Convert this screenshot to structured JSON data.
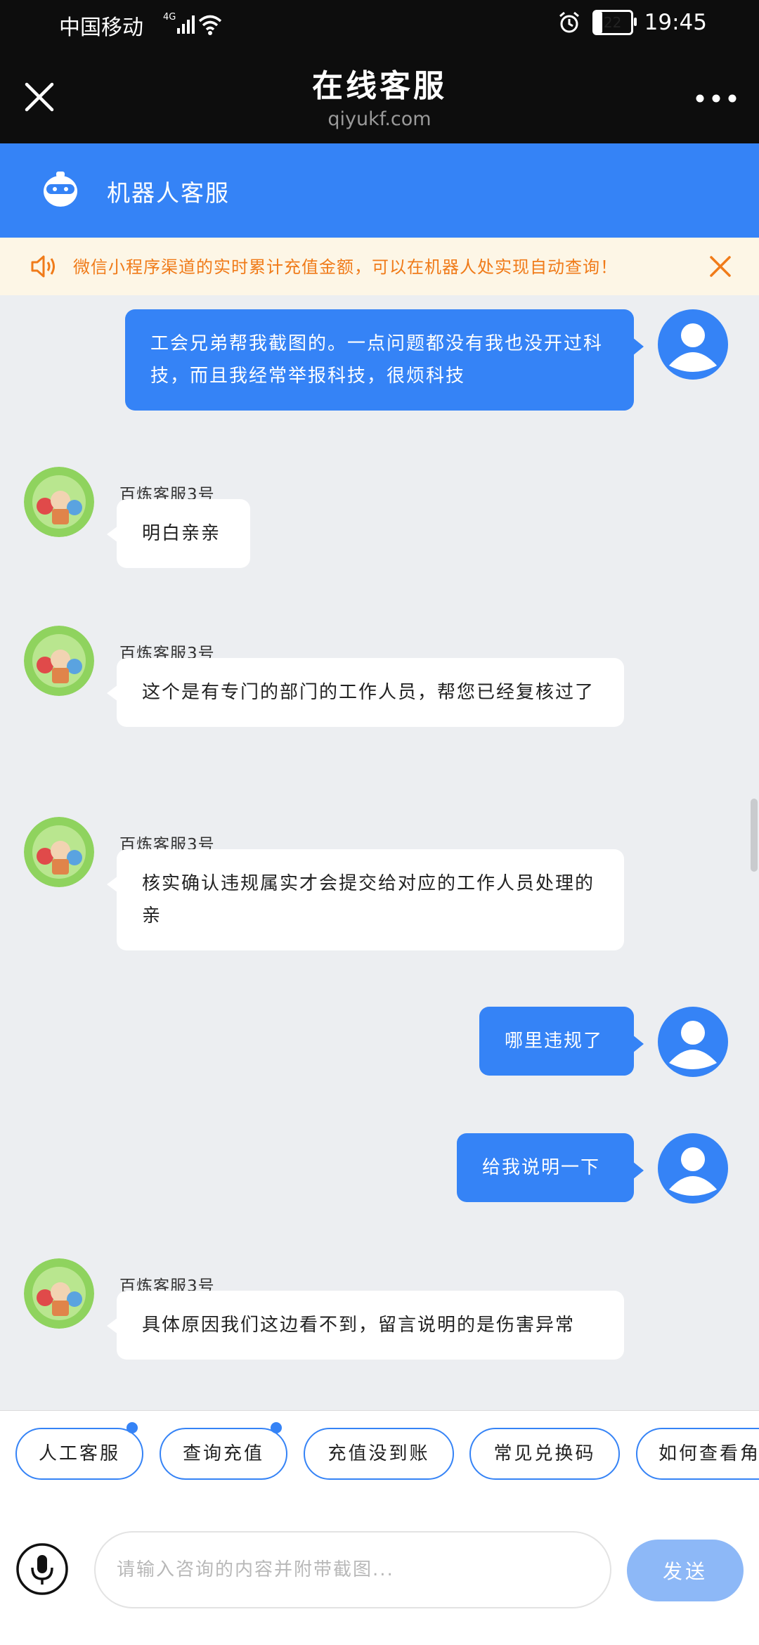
{
  "status_bar": {
    "carrier": "中国移动",
    "network": "4G",
    "battery": "22",
    "time": "19:45"
  },
  "title_bar": {
    "title": "在线客服",
    "subtitle": "qiyukf.com"
  },
  "agent_header": {
    "name": "机器人客服"
  },
  "notice": {
    "text": "微信小程序渠道的实时累计充值金额，可以在机器人处实现自动查询！"
  },
  "messages": [
    {
      "from": "user",
      "text": "工会兄弟帮我截图的。一点问题都没有我也没开过科技，而且我经常举报科技，很烦科技"
    },
    {
      "from": "agent",
      "sender": "百炼客服3号",
      "text": "明白亲亲"
    },
    {
      "from": "agent",
      "sender": "百炼客服3号",
      "text": "这个是有专门的部门的工作人员，帮您已经复核过了"
    },
    {
      "from": "agent",
      "sender": "百炼客服3号",
      "text": "核实确认违规属实才会提交给对应的工作人员处理的亲"
    },
    {
      "from": "user",
      "text": "哪里违规了"
    },
    {
      "from": "user",
      "text": "给我说明一下"
    },
    {
      "from": "agent",
      "sender": "百炼客服3号",
      "text": "具体原因我们这边看不到，留言说明的是伤害异常"
    }
  ],
  "quick_replies": [
    "人工客服",
    "查询充值",
    "充值没到账",
    "常见兑换码",
    "如何查看角"
  ],
  "input": {
    "placeholder": "请输入咨询的内容并附带截图...",
    "send_label": "发送"
  },
  "colors": {
    "primary": "#3583f6",
    "notice_text": "#f07b19",
    "notice_bg": "#fdf6e6",
    "send_disabled": "#8db8f7"
  }
}
